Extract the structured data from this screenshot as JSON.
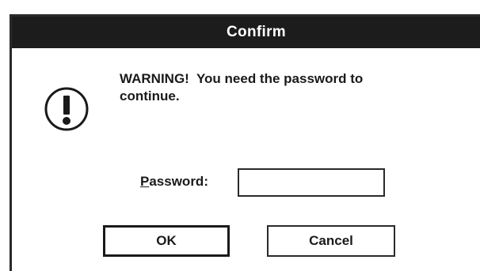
{
  "window": {
    "title": "Confirm"
  },
  "message": {
    "text": "WARNING!  You need the password to\ncontinue.",
    "icon": "exclamation-icon"
  },
  "password_field": {
    "label_accel": "P",
    "label_rest": "assword:",
    "value": "",
    "placeholder": ""
  },
  "buttons": {
    "ok_label": "OK",
    "cancel_label": "Cancel"
  },
  "colors": {
    "titlebar": "#1c1c1c",
    "title_text": "#ffffff",
    "border": "#2a2a2a",
    "background": "#ffffff"
  }
}
